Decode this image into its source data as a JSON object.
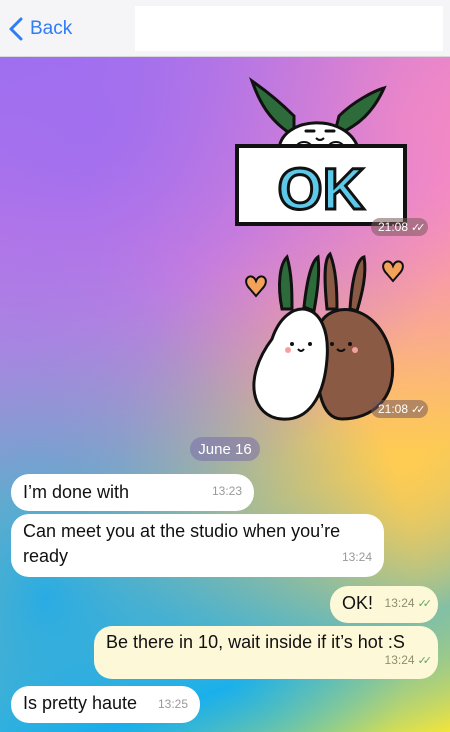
{
  "header": {
    "back_label": "Back"
  },
  "stickers": [
    {
      "name": "ok-bunny-sticker",
      "sign_text": "OK",
      "time": "21:08"
    },
    {
      "name": "hugging-bunnies-sticker",
      "time": "21:08"
    }
  ],
  "date_separator": "June 16",
  "messages": [
    {
      "dir": "in",
      "text": "I’m done with",
      "time": "13:23"
    },
    {
      "dir": "in",
      "text_line1": "Can meet you at the studio when you’re",
      "text_line2": "ready",
      "time": "13:24"
    },
    {
      "dir": "out",
      "text": "OK!",
      "time": "13:24"
    },
    {
      "dir": "out",
      "text": "Be there in 10, wait inside if it’s hot :S",
      "time": "13:24"
    },
    {
      "dir": "in",
      "text": "Is pretty haute",
      "time": "13:25"
    }
  ],
  "colors": {
    "accent": "#2f7cf6",
    "incoming": "#ffffff",
    "outgoing": "#fdf8d8"
  }
}
